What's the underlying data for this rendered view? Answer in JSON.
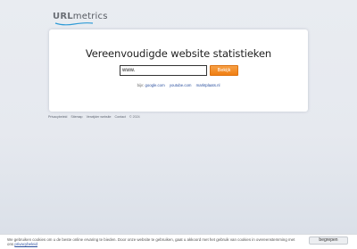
{
  "logo": {
    "part1": "URL",
    "part2": "metrics",
    "swoosh_color": "#2f9bd6"
  },
  "main": {
    "title": "Vereenvoudigde website statistieken",
    "search": {
      "value": "www.",
      "placeholder": ""
    },
    "button_label": "Bekijk",
    "examples": {
      "prefix": "bijv:",
      "links": [
        "google.com",
        "youtube.com",
        "marktplaats.nl"
      ]
    }
  },
  "footer": {
    "links": [
      "Privacybeleid",
      "Sitemap",
      "Verwijder website",
      "Contact"
    ],
    "copyright": "© 2024"
  },
  "cookie": {
    "text": "We gebruiken cookies om u de beste online ervaring te bieden. Door onze website te gebruiken, gaat u akkoord met het gebruik van cookies in overeenstemming met ons",
    "link": "privacybeleid",
    "button": "begrepen"
  },
  "colors": {
    "accent": "#f07e12",
    "link": "#2a4f9e"
  }
}
